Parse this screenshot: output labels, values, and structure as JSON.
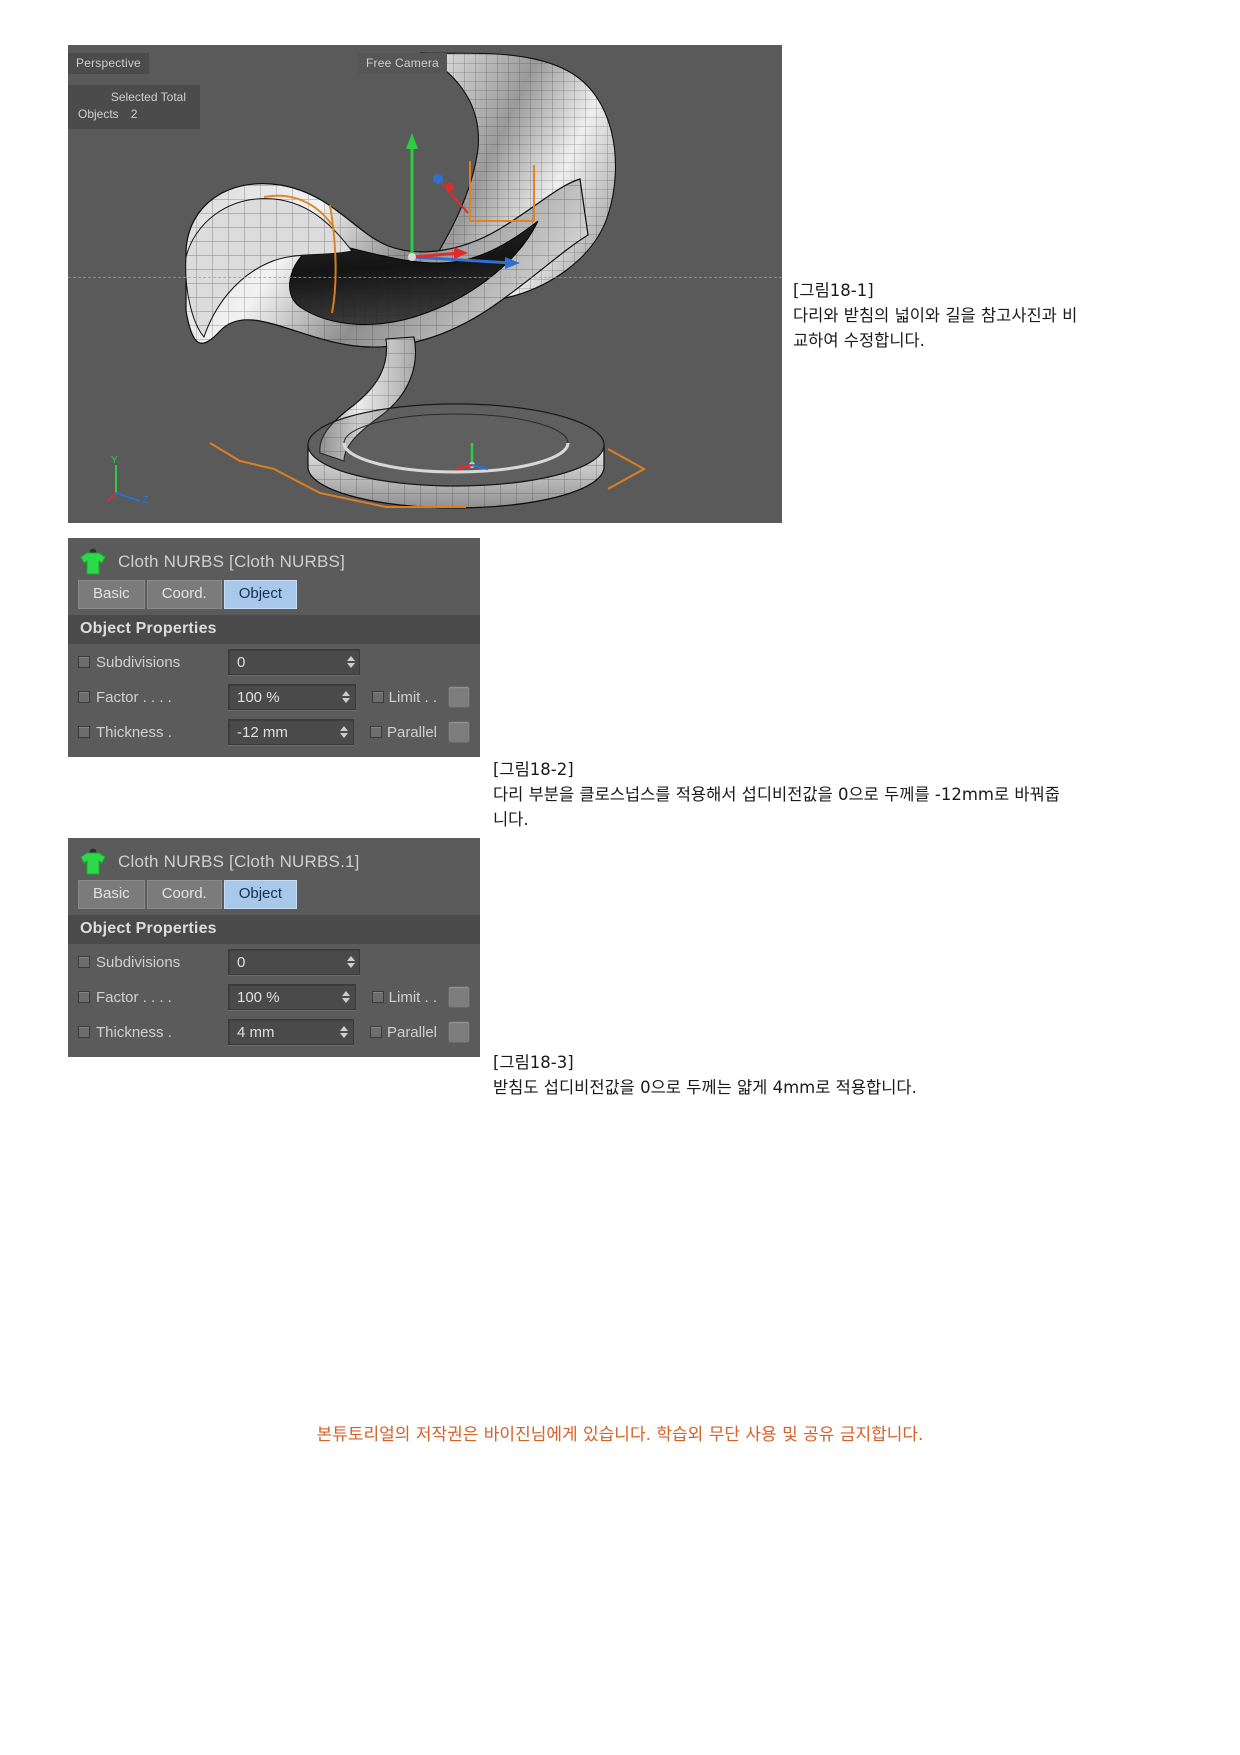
{
  "viewport": {
    "perspective_label": "Perspective",
    "camera_label": "Free Camera",
    "stats_header": "Selected Total",
    "stats_row_label": "Objects",
    "stats_row_value": "2",
    "axis": {
      "y": "Y",
      "x": "X",
      "z": "Z"
    },
    "background_color": "#5a5a5a"
  },
  "panels": [
    {
      "title": "Cloth NURBS [Cloth NURBS]",
      "icon": "cloth-nurbs-icon",
      "tabs": [
        {
          "label": "Basic",
          "selected": false
        },
        {
          "label": "Coord.",
          "selected": false
        },
        {
          "label": "Object",
          "selected": true
        }
      ],
      "section_title": "Object Properties",
      "rows": [
        {
          "label": "Subdivisions",
          "value": "0",
          "extra": null
        },
        {
          "label": "Factor . . . .",
          "value": "100 %",
          "extra": "Limit . ."
        },
        {
          "label": "Thickness .",
          "value": "-12 mm",
          "extra": "Parallel"
        }
      ]
    },
    {
      "title": "Cloth NURBS [Cloth NURBS.1]",
      "icon": "cloth-nurbs-icon",
      "tabs": [
        {
          "label": "Basic",
          "selected": false
        },
        {
          "label": "Coord.",
          "selected": false
        },
        {
          "label": "Object",
          "selected": true
        }
      ],
      "section_title": "Object Properties",
      "rows": [
        {
          "label": "Subdivisions",
          "value": "0",
          "extra": null
        },
        {
          "label": "Factor . . . .",
          "value": "100 %",
          "extra": "Limit . ."
        },
        {
          "label": "Thickness .",
          "value": "4 mm",
          "extra": "Parallel"
        }
      ]
    }
  ],
  "captions": [
    {
      "title": "[그림18-1]",
      "body": "다리와 받침의 넓이와 길을 참고사진과 비교하여 수정합니다."
    },
    {
      "title": "[그림18-2]",
      "body": "다리 부분을 클로스넙스를 적용해서 섭디비전값을 0으로 두께를 -12mm로 바꿔줍니다."
    },
    {
      "title": "[그림18-3]",
      "body": "받침도 섭디비전값을 0으로 두께는 얇게 4mm로 적용합니다."
    }
  ],
  "footer": {
    "text": "본튜토리얼의 저작권은 바이진님에게 있습니다. 학습외 무단 사용 및 공유 금지합니다.",
    "color": "#d4622a"
  }
}
